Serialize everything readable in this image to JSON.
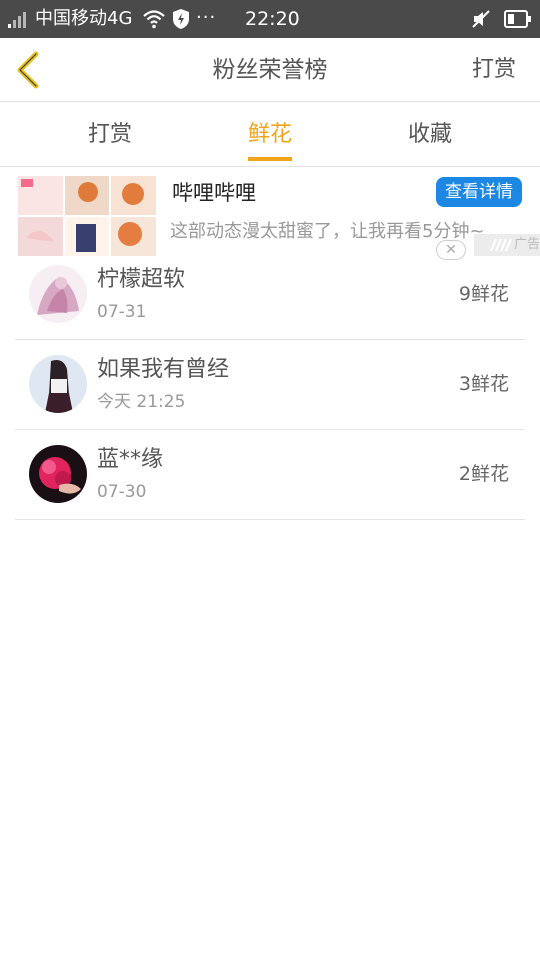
{
  "status_bar": {
    "carrier": "中国移动4G",
    "more": "···",
    "time": "22:20"
  },
  "header": {
    "title": "粉丝荣誉榜",
    "action_label": "打赏"
  },
  "tabs": [
    {
      "label": "打赏",
      "active": false
    },
    {
      "label": "鲜花",
      "active": true
    },
    {
      "label": "收藏",
      "active": false
    }
  ],
  "ad": {
    "name": "哔哩哔哩",
    "button_label": "查看详情",
    "description": "这部动态漫太甜蜜了，让我再看5分钟~",
    "close_label": "✕",
    "tag": "广告"
  },
  "list": [
    {
      "name": "柠檬超软",
      "date": "07-31",
      "count": "9鲜花"
    },
    {
      "name": "如果我有曾经",
      "date": "今天 21:25",
      "count": "3鲜花"
    },
    {
      "name": "蓝**缘",
      "date": "07-30",
      "count": "2鲜花"
    }
  ],
  "colors": {
    "accent": "#f2a41b",
    "status_bar": "#4a4a4a",
    "ad_button": "#1d87e4"
  }
}
